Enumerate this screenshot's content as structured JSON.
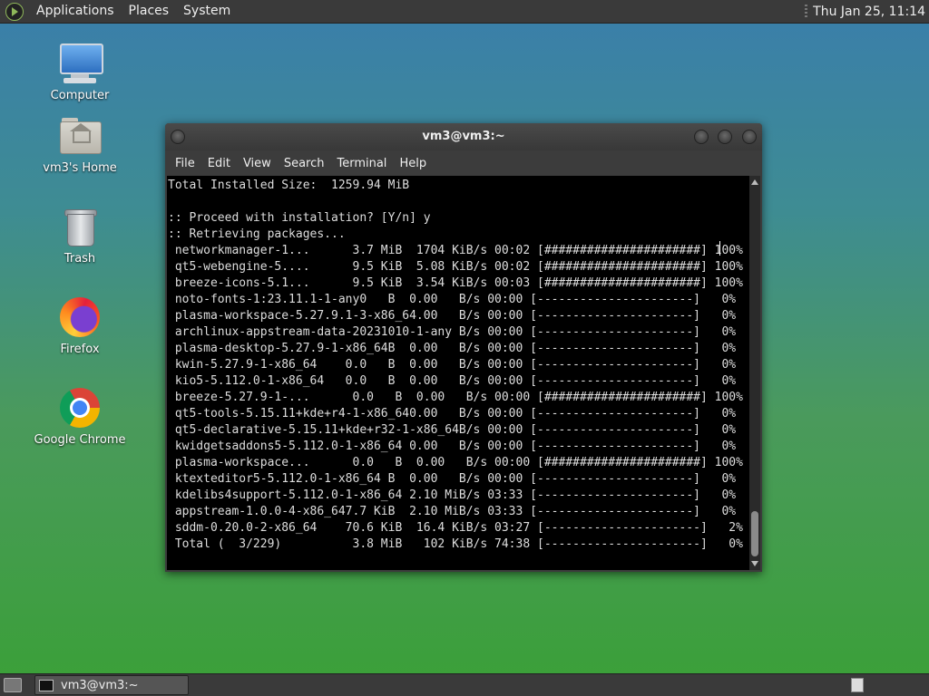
{
  "top_panel": {
    "menus": [
      "Applications",
      "Places",
      "System"
    ],
    "clock": "Thu Jan 25, 11:14"
  },
  "desktop_icons": [
    {
      "label": "Computer",
      "icon": "computer-icon"
    },
    {
      "label": "vm3's Home",
      "icon": "home-folder-icon"
    },
    {
      "label": "Trash",
      "icon": "trash-icon"
    },
    {
      "label": "Firefox",
      "icon": "firefox-icon"
    },
    {
      "label": "Google Chrome",
      "icon": "chrome-icon"
    }
  ],
  "window": {
    "title": "vm3@vm3:~",
    "menu": [
      "File",
      "Edit",
      "View",
      "Search",
      "Terminal",
      "Help"
    ],
    "terminal_lines": [
      "Total Installed Size:  1259.94 MiB",
      "",
      ":: Proceed with installation? [Y/n] y",
      ":: Retrieving packages...",
      " networkmanager-1...      3.7 MiB  1704 KiB/s 00:02 [######################] 100%",
      " qt5-webengine-5....      9.5 KiB  5.08 KiB/s 00:02 [######################] 100%",
      " breeze-icons-5.1...      9.5 KiB  3.54 KiB/s 00:03 [######################] 100%",
      " noto-fonts-1:23.11.1-1-any0   B  0.00   B/s 00:00 [----------------------]   0%",
      " plasma-workspace-5.27.9.1-3-x86_64.00   B/s 00:00 [----------------------]   0%",
      " archlinux-appstream-data-20231010-1-any B/s 00:00 [----------------------]   0%",
      " plasma-desktop-5.27.9-1-x86_64B  0.00   B/s 00:00 [----------------------]   0%",
      " kwin-5.27.9-1-x86_64    0.0   B  0.00   B/s 00:00 [----------------------]   0%",
      " kio5-5.112.0-1-x86_64   0.0   B  0.00   B/s 00:00 [----------------------]   0%",
      " breeze-5.27.9-1-...      0.0   B  0.00   B/s 00:00 [######################] 100%",
      " qt5-tools-5.15.11+kde+r4-1-x86_640.00   B/s 00:00 [----------------------]   0%",
      " qt5-declarative-5.15.11+kde+r32-1-x86_64B/s 00:00 [----------------------]   0%",
      " kwidgetsaddons5-5.112.0-1-x86_64 0.00   B/s 00:00 [----------------------]   0%",
      " plasma-workspace...      0.0   B  0.00   B/s 00:00 [######################] 100%",
      " ktexteditor5-5.112.0-1-x86_64 B  0.00   B/s 00:00 [----------------------]   0%",
      " kdelibs4support-5.112.0-1-x86_64 2.10 MiB/s 03:33 [----------------------]   0%",
      " appstream-1.0.0-4-x86_647.7 KiB  2.10 MiB/s 03:33 [----------------------]   0%",
      " sddm-0.20.0-2-x86_64    70.6 KiB  16.4 KiB/s 03:27 [----------------------]   2%",
      " Total (  3/229)          3.8 MiB   102 KiB/s 74:38 [----------------------]   0%"
    ]
  },
  "taskbar": {
    "task_label": "vm3@vm3:~"
  }
}
